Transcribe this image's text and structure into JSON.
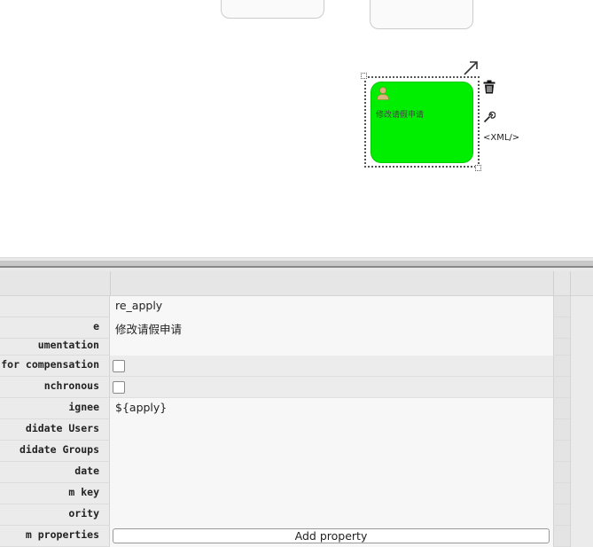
{
  "canvas": {
    "task": {
      "name": "修改请假申请",
      "fill_color": "#00ee00"
    },
    "toolbar": {
      "xml_label": "<XML/>"
    }
  },
  "properties": {
    "rows": [
      {
        "label": "",
        "value": "re_apply",
        "type": "text"
      },
      {
        "label": "e",
        "value": "修改请假申请",
        "type": "text"
      },
      {
        "label": "umentation",
        "value": "",
        "type": "text"
      },
      {
        "label": "for compensation",
        "value": "",
        "type": "checkbox",
        "checked": false
      },
      {
        "label": "nchronous",
        "value": "",
        "type": "checkbox",
        "checked": false
      },
      {
        "label": "ignee",
        "value": "${apply}",
        "type": "text"
      },
      {
        "label": "didate Users",
        "value": "",
        "type": "text"
      },
      {
        "label": "didate Groups",
        "value": "",
        "type": "text"
      },
      {
        "label": " date",
        "value": "",
        "type": "text"
      },
      {
        "label": "m key",
        "value": "",
        "type": "text"
      },
      {
        "label": "ority",
        "value": "",
        "type": "text"
      },
      {
        "label": "m properties",
        "value": "",
        "type": "button",
        "button_label": "Add property"
      }
    ]
  }
}
